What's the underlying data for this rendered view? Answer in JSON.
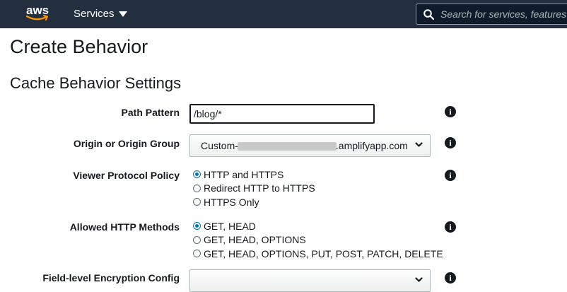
{
  "topbar": {
    "logo_text": "aws",
    "services_label": "Services",
    "search_placeholder": "Search for services, features"
  },
  "page": {
    "title": "Create Behavior",
    "section_title": "Cache Behavior Settings"
  },
  "form": {
    "path_pattern": {
      "label": "Path Pattern",
      "value": "/blog/*"
    },
    "origin": {
      "label": "Origin or Origin Group",
      "value_prefix": "Custom-",
      "value_suffix": ".amplifyapp.com"
    },
    "viewer_protocol": {
      "label": "Viewer Protocol Policy",
      "options": [
        "HTTP and HTTPS",
        "Redirect HTTP to HTTPS",
        "HTTPS Only"
      ],
      "selected": 0
    },
    "allowed_methods": {
      "label": "Allowed HTTP Methods",
      "options": [
        "GET, HEAD",
        "GET, HEAD, OPTIONS",
        "GET, HEAD, OPTIONS, PUT, POST, PATCH, DELETE"
      ],
      "selected": 0
    },
    "fle_config": {
      "label": "Field-level Encryption Config",
      "value": ""
    },
    "info_icon": "i"
  },
  "colors": {
    "topbar": "#232f3e",
    "accent": "#0073bb",
    "logo_smile": "#ff9900"
  }
}
